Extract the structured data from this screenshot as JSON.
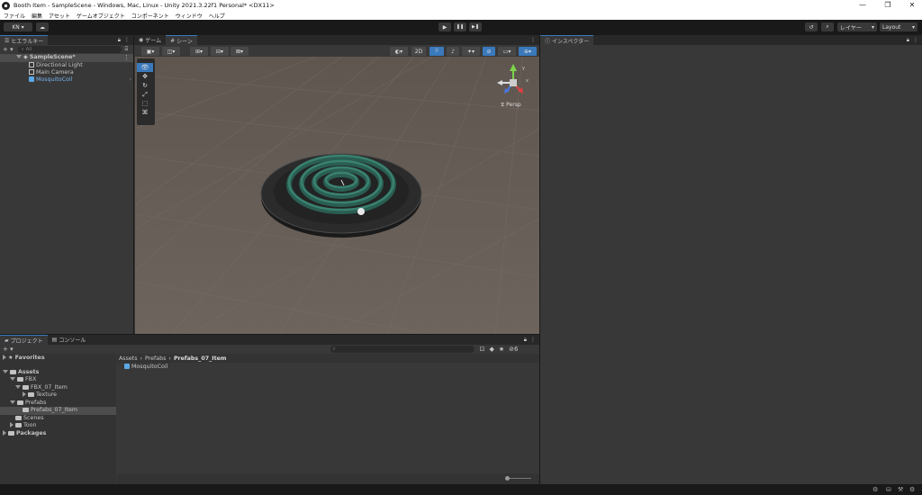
{
  "window": {
    "title": "Booth Item - SampleScene - Windows, Mac, Linux - Unity 2021.3.22f1 Personal* <DX11>"
  },
  "menu": [
    "ファイル",
    "編集",
    "アセット",
    "ゲームオブジェクト",
    "コンポーネント",
    "ウィンドウ",
    "ヘルプ"
  ],
  "toolbar": {
    "account": "KN ▾",
    "cloud": "☁",
    "play": "▶",
    "pause": "❚❚",
    "step": "▶❚",
    "history": "↺",
    "search": "⌕",
    "layers": "レイヤー",
    "layout": "Layout"
  },
  "hierarchy": {
    "tab": "ヒエラルキー",
    "add": "+ ▾",
    "search_placeholder": "All",
    "scene": "SampleScene*",
    "items": [
      "Directional Light",
      "Main Camera",
      "MosquitoCoil"
    ]
  },
  "scene": {
    "tabs": [
      "ゲーム",
      "シーン"
    ],
    "mode2d": "2D",
    "gizmo_label": "Persp"
  },
  "inspector": {
    "tab": "インスペクター"
  },
  "project": {
    "tabs": [
      "プロジェクト",
      "コンソール"
    ],
    "add": "+ ▾",
    "hidden_count": "6",
    "favorites": "Favorites",
    "assets": "Assets",
    "tree": [
      "FBX",
      "FBX_07_Item",
      "Texture",
      "Prefabs",
      "Prefabs_07_Item",
      "Scenes",
      "Toon"
    ],
    "packages": "Packages",
    "breadcrumb": [
      "Assets",
      "Prefabs",
      "Prefabs_07_Item"
    ],
    "files": [
      "MosquitoCoil"
    ]
  },
  "colors": {
    "accent": "#3a79bb",
    "selected": "#4d4d4d",
    "prefab": "#7bb6f0"
  }
}
